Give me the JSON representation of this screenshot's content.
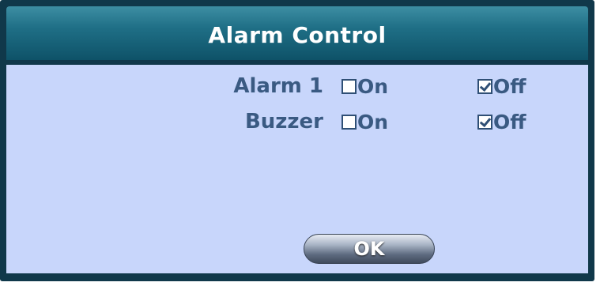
{
  "dialog": {
    "title": "Alarm Control",
    "rows": [
      {
        "label": "Alarm 1",
        "on_label": "On",
        "off_label": "Off",
        "on_checked": false,
        "off_checked": true
      },
      {
        "label": "Buzzer",
        "on_label": "On",
        "off_label": "Off",
        "on_checked": false,
        "off_checked": true
      }
    ],
    "ok_label": "OK"
  },
  "colors": {
    "frame": "#10384a",
    "title_bar": "#1f6f86",
    "panel": "#c8d6fb",
    "label_text": "#3a5a82"
  }
}
